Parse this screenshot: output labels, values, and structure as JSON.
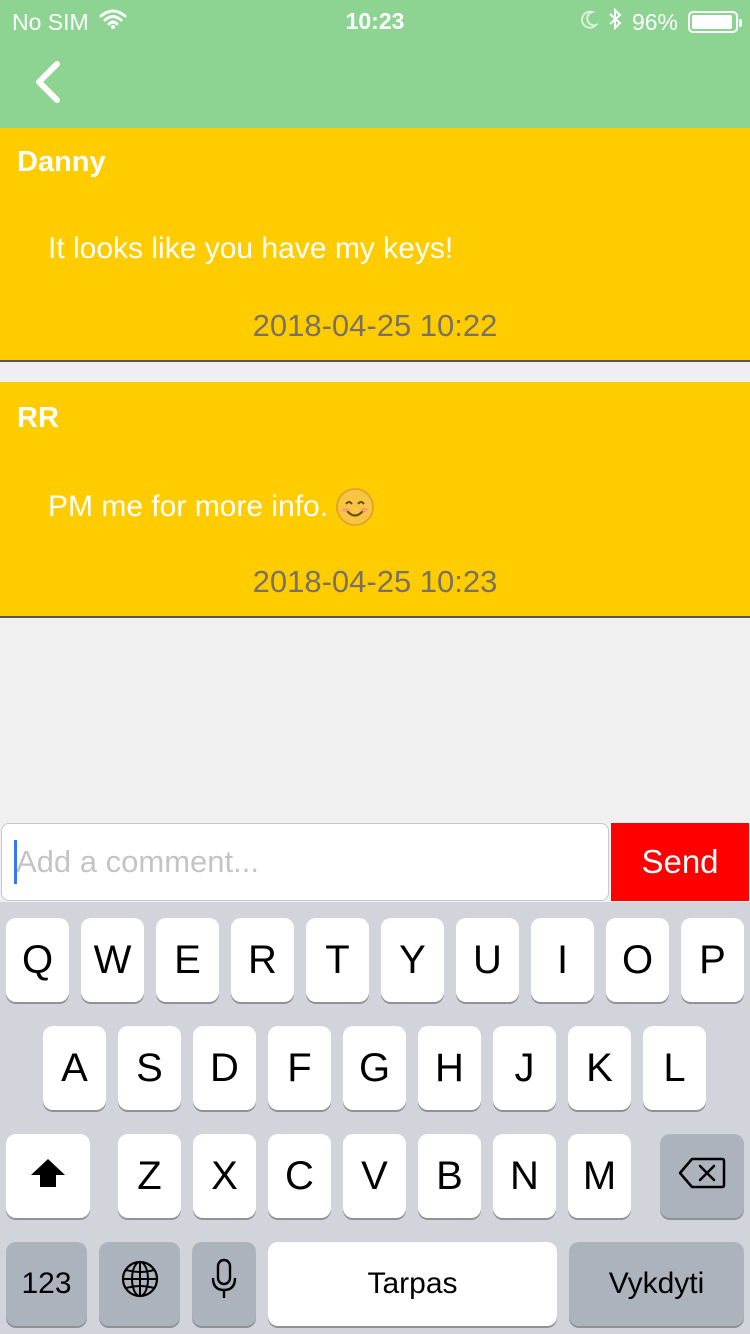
{
  "status_bar": {
    "carrier": "No SIM",
    "time": "10:23",
    "battery": "96%",
    "battery_level": 0.96,
    "icons": [
      "wifi-icon",
      "moon-icon",
      "bluetooth-icon",
      "battery-icon"
    ]
  },
  "nav": {
    "back_icon": "chevron-left-icon"
  },
  "comments": [
    {
      "author": "Danny",
      "text": "It looks like you have my keys!",
      "timestamp": "2018-04-25 10:22"
    },
    {
      "author": "RR",
      "text": "PM me for more info.",
      "emoji": "smiling-face-icon",
      "timestamp": "2018-04-25 10:23"
    }
  ],
  "composer": {
    "placeholder": "Add a comment...",
    "value": "",
    "send_label": "Send"
  },
  "keyboard": {
    "row1": [
      "Q",
      "W",
      "E",
      "R",
      "T",
      "Y",
      "U",
      "I",
      "O",
      "P"
    ],
    "row2": [
      "A",
      "S",
      "D",
      "F",
      "G",
      "H",
      "J",
      "K",
      "L"
    ],
    "row3": [
      "Z",
      "X",
      "C",
      "V",
      "B",
      "N",
      "M"
    ],
    "numbers_label": "123",
    "space_label": "Tarpas",
    "return_label": "Vykdyti",
    "shift_icon": "shift-icon",
    "delete_icon": "delete-icon",
    "globe_icon": "globe-icon",
    "mic_icon": "microphone-icon"
  },
  "colors": {
    "header": "#8dd391",
    "comment_bg": "#ffcc00",
    "send_button": "#ff0000",
    "keyboard_bg": "#d1d4da"
  }
}
